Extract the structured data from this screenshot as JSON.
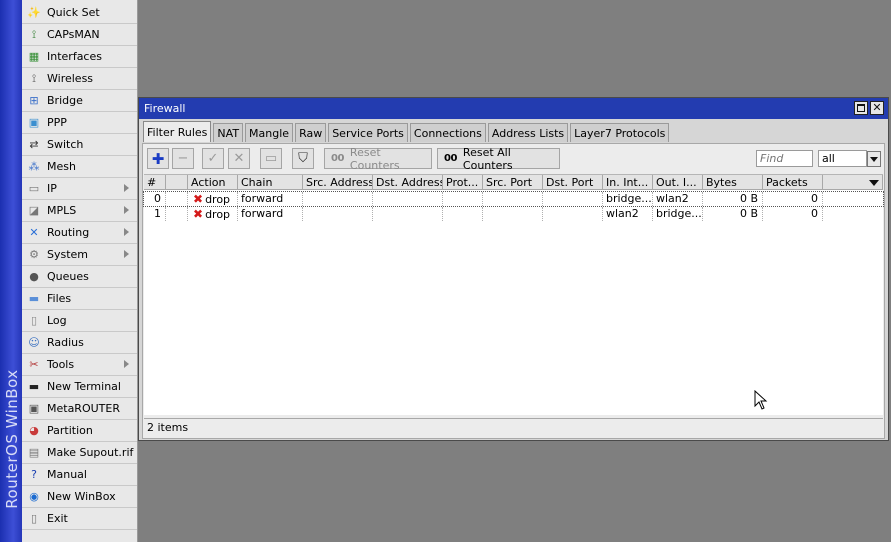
{
  "brand": {
    "text": "RouterOS WinBox"
  },
  "menu": [
    {
      "label": "Quick Set",
      "icon": "wand-icon",
      "glyph": "✨",
      "color": "#666666",
      "submenu": false
    },
    {
      "label": "CAPsMAN",
      "icon": "capsman-icon",
      "glyph": "⟟",
      "color": "#2f7d2f",
      "submenu": false
    },
    {
      "label": "Interfaces",
      "icon": "interfaces-icon",
      "glyph": "▦",
      "color": "#2e8b2e",
      "submenu": false
    },
    {
      "label": "Wireless",
      "icon": "wireless-icon",
      "glyph": "⟟",
      "color": "#555555",
      "submenu": false
    },
    {
      "label": "Bridge",
      "icon": "bridge-icon",
      "glyph": "⊞",
      "color": "#3a6fc9",
      "submenu": false
    },
    {
      "label": "PPP",
      "icon": "ppp-icon",
      "glyph": "▣",
      "color": "#3a8fd0",
      "submenu": false
    },
    {
      "label": "Switch",
      "icon": "switch-icon",
      "glyph": "⇄",
      "color": "#333333",
      "submenu": false
    },
    {
      "label": "Mesh",
      "icon": "mesh-icon",
      "glyph": "⁂",
      "color": "#3a6fc9",
      "submenu": false
    },
    {
      "label": "IP",
      "icon": "ip-icon",
      "glyph": "▭",
      "color": "#777777",
      "submenu": true
    },
    {
      "label": "MPLS",
      "icon": "mpls-icon",
      "glyph": "◪",
      "color": "#777777",
      "submenu": true
    },
    {
      "label": "Routing",
      "icon": "routing-icon",
      "glyph": "✕",
      "color": "#2a6fd6",
      "submenu": true
    },
    {
      "label": "System",
      "icon": "gear-icon",
      "glyph": "⚙",
      "color": "#777777",
      "submenu": true
    },
    {
      "label": "Queues",
      "icon": "queues-icon",
      "glyph": "●",
      "color": "#555555",
      "submenu": false
    },
    {
      "label": "Files",
      "icon": "folder-icon",
      "glyph": "▬",
      "color": "#5a8fd8",
      "submenu": false
    },
    {
      "label": "Log",
      "icon": "log-icon",
      "glyph": "▯",
      "color": "#888888",
      "submenu": false
    },
    {
      "label": "Radius",
      "icon": "radius-icon",
      "glyph": "☺",
      "color": "#3a70c0",
      "submenu": false
    },
    {
      "label": "Tools",
      "icon": "tools-icon",
      "glyph": "✂",
      "color": "#b03030",
      "submenu": true
    },
    {
      "label": "New Terminal",
      "icon": "terminal-icon",
      "glyph": "▬",
      "color": "#222222",
      "submenu": false
    },
    {
      "label": "MetaROUTER",
      "icon": "metarouter-icon",
      "glyph": "▣",
      "color": "#555555",
      "submenu": false
    },
    {
      "label": "Partition",
      "icon": "partition-icon",
      "glyph": "◕",
      "color": "#c83a3a",
      "submenu": false
    },
    {
      "label": "Make Supout.rif",
      "icon": "supout-icon",
      "glyph": "▤",
      "color": "#777777",
      "submenu": false
    },
    {
      "label": "Manual",
      "icon": "help-icon",
      "glyph": "?",
      "color": "#1a40b0",
      "submenu": false
    },
    {
      "label": "New WinBox",
      "icon": "winbox-icon",
      "glyph": "◉",
      "color": "#1a6ad0",
      "submenu": false
    },
    {
      "label": "Exit",
      "icon": "exit-icon",
      "glyph": "▯",
      "color": "#777777",
      "submenu": false
    }
  ],
  "window": {
    "title": "Firewall",
    "close_glyph": "✕"
  },
  "tabs": [
    {
      "label": "Filter Rules",
      "active": true
    },
    {
      "label": "NAT",
      "active": false
    },
    {
      "label": "Mangle",
      "active": false
    },
    {
      "label": "Raw",
      "active": false
    },
    {
      "label": "Service Ports",
      "active": false
    },
    {
      "label": "Connections",
      "active": false
    },
    {
      "label": "Address Lists",
      "active": false
    },
    {
      "label": "Layer7 Protocols",
      "active": false
    }
  ],
  "toolbar": {
    "add_glyph": "✚",
    "remove_glyph": "−",
    "enable_glyph": "✓",
    "disable_glyph": "✕",
    "comment_glyph": "▭",
    "filter_glyph": "⛉",
    "counter_glyph": "00",
    "reset_counters_label": "Reset Counters",
    "reset_all_counters_label": "Reset All Counters",
    "find_placeholder": "Find",
    "filter_value": "all"
  },
  "table": {
    "columns": [
      "#",
      "",
      "Action",
      "Chain",
      "Src. Address",
      "Dst. Address",
      "Prot...",
      "Src. Port",
      "Dst. Port",
      "In. Int...",
      "Out. I...",
      "Bytes",
      "Packets"
    ],
    "rows": [
      {
        "num": "0",
        "action": "drop",
        "chain": "forward",
        "src_address": "",
        "dst_address": "",
        "protocol": "",
        "src_port": "",
        "dst_port": "",
        "in_interface": "bridge...",
        "out_interface": "wlan2",
        "bytes": "0 B",
        "packets": "0"
      },
      {
        "num": "1",
        "action": "drop",
        "chain": "forward",
        "src_address": "",
        "dst_address": "",
        "protocol": "",
        "src_port": "",
        "dst_port": "",
        "in_interface": "wlan2",
        "out_interface": "bridge...",
        "bytes": "0 B",
        "packets": "0"
      }
    ],
    "action_glyph": "✖"
  },
  "status": {
    "count": "2 items"
  }
}
